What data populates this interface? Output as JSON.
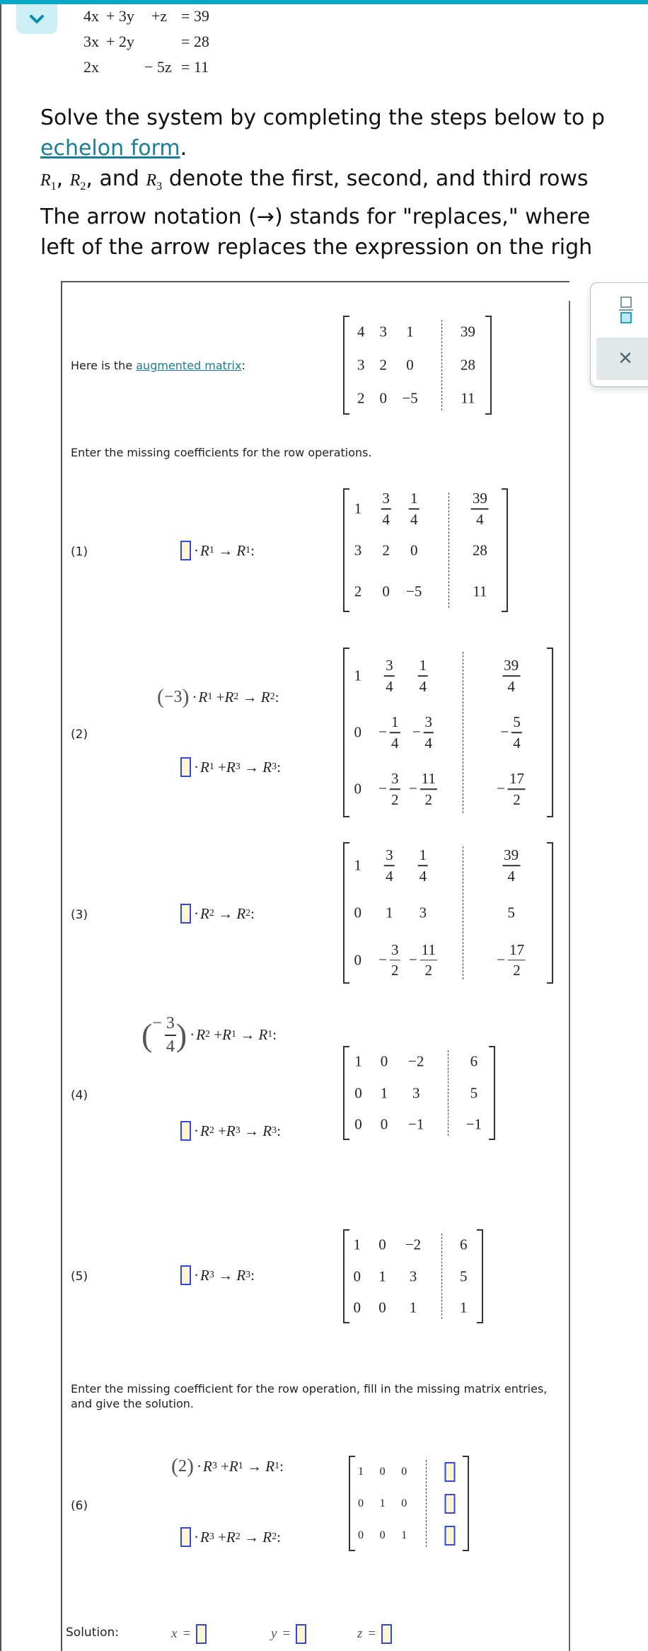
{
  "header": {
    "collapse_button": "chevron-down",
    "colors": {
      "accent": "#0aa8c6",
      "link": "#1a7f99",
      "answer_box_fill": "#fdf6d3",
      "answer_box_border": "#3447e0"
    }
  },
  "system": {
    "equations": [
      {
        "x": "4x",
        "y": "+ 3y",
        "z": "+z",
        "rhs": "= 39"
      },
      {
        "x": "3x",
        "y": "+ 2y",
        "z": "",
        "rhs": "= 28"
      },
      {
        "x": "2x",
        "y": "",
        "z": "− 5z",
        "rhs": "= 11"
      }
    ]
  },
  "intro": {
    "line1": "Solve the system by completing the steps below to p",
    "link": "echelon form",
    "link_after": ".",
    "rows_r1": "R",
    "rows_sub1": "1",
    "rows_r2": "R",
    "rows_sub2": "2",
    "rows_r3": "R",
    "rows_sub3": "3",
    "rows_and": ", and ",
    "rows_comma": ", ",
    "rows_text": " denote the first, second, and third rows",
    "line4": "The arrow notation (→) stands for \"replaces,\" where",
    "line5": "left of the arrow replaces the expression on the righ"
  },
  "side_tools": {
    "fraction_label": "fraction-template",
    "close_label": "✕"
  },
  "panel": {
    "augmented_prefix": "Here is the ",
    "augmented_link": "augmented matrix",
    "augmented_suffix": ":",
    "instructions_1": "Enter the missing coefficients for the row operations.",
    "instructions_2": "Enter the missing coefficient for the row operation, fill in the missing matrix entries, and give the solution.",
    "augmented_matrix": [
      [
        "4",
        "3",
        "1",
        "39"
      ],
      [
        "3",
        "2",
        "0",
        "28"
      ],
      [
        "2",
        "0",
        "−5",
        "11"
      ]
    ],
    "steps": [
      {
        "num": "(1)",
        "ops": [
          {
            "coef": "",
            "src": "1",
            "plus": "",
            "dst": "1"
          }
        ],
        "matrix": [
          [
            "1",
            "3/4",
            "1/4",
            "39/4"
          ],
          [
            "3",
            "2",
            "0",
            "28"
          ],
          [
            "2",
            "0",
            "−5",
            "11"
          ]
        ]
      },
      {
        "num": "(2)",
        "ops": [
          {
            "coef": "−3",
            "src": "1",
            "plus": "2",
            "dst": "2"
          },
          {
            "coef": "",
            "src": "1",
            "plus": "3",
            "dst": "3"
          }
        ],
        "matrix": [
          [
            "1",
            "3/4",
            "1/4",
            "39/4"
          ],
          [
            "0",
            "−1/4",
            "−3/4",
            "−5/4"
          ],
          [
            "0",
            "−3/2",
            "−11/2",
            "−17/2"
          ]
        ]
      },
      {
        "num": "(3)",
        "ops": [
          {
            "coef": "",
            "src": "2",
            "plus": "",
            "dst": "2"
          }
        ],
        "matrix": [
          [
            "1",
            "3/4",
            "1/4",
            "39/4"
          ],
          [
            "0",
            "1",
            "3",
            "5"
          ],
          [
            "0",
            "−3/2",
            "−11/2",
            "−17/2"
          ]
        ]
      },
      {
        "num": "(4)",
        "ops": [
          {
            "coef": "−3/4",
            "src": "2",
            "plus": "1",
            "dst": "1"
          },
          {
            "coef": "",
            "src": "2",
            "plus": "3",
            "dst": "3"
          }
        ],
        "matrix": [
          [
            "1",
            "0",
            "−2",
            "6"
          ],
          [
            "0",
            "1",
            "3",
            "5"
          ],
          [
            "0",
            "0",
            "−1",
            "−1"
          ]
        ]
      },
      {
        "num": "(5)",
        "ops": [
          {
            "coef": "",
            "src": "3",
            "plus": "",
            "dst": "3"
          }
        ],
        "matrix": [
          [
            "1",
            "0",
            "−2",
            "6"
          ],
          [
            "0",
            "1",
            "3",
            "5"
          ],
          [
            "0",
            "0",
            "1",
            "1"
          ]
        ]
      },
      {
        "num": "(6)",
        "ops": [
          {
            "coef": "2",
            "src": "3",
            "plus": "1",
            "dst": "1"
          },
          {
            "coef": "",
            "src": "3",
            "plus": "2",
            "dst": "2"
          }
        ],
        "matrix": [
          [
            "1",
            "0",
            "0",
            ""
          ],
          [
            "0",
            "1",
            "0",
            ""
          ],
          [
            "0",
            "0",
            "1",
            ""
          ]
        ]
      }
    ],
    "symbols": {
      "R": "R",
      "arrow": "→",
      "colon": ":",
      "dot": "·",
      "plus": "+"
    },
    "solution": {
      "label": "Solution:",
      "vars": [
        {
          "name": "x",
          "value": ""
        },
        {
          "name": "y",
          "value": ""
        },
        {
          "name": "z",
          "value": ""
        }
      ],
      "eq": "="
    }
  }
}
